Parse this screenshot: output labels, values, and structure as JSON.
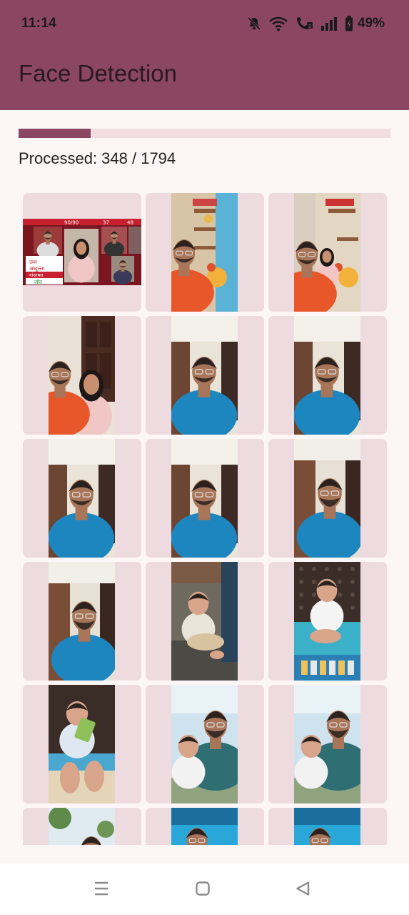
{
  "status_bar": {
    "time": "11:14",
    "battery": "49%",
    "icons": [
      "mute-bell-icon",
      "wifi-icon",
      "wifi-call-icon",
      "signal-icon",
      "battery-charging-icon"
    ]
  },
  "app_bar": {
    "title": "Face Detection"
  },
  "progress": {
    "label": "Processed: 348 / 1794",
    "processed": 348,
    "total": 1794,
    "fraction": 0.194,
    "track_color": "#f1dde2",
    "fill_color": "#8b4762"
  },
  "colors": {
    "primary": "#8b4762",
    "background": "#fdf6f7",
    "tile": "#eedbe0"
  },
  "photos": [
    {
      "orientation": "landscape",
      "scene": "news-panel",
      "overlay_text": [
        "90/90",
        "37",
        "48",
        "उमर",
        "अब्दुल्ला",
        "गांदरबल",
        "जीत"
      ]
    },
    {
      "orientation": "portrait",
      "scene": "selfie-temple"
    },
    {
      "orientation": "portrait",
      "scene": "selfie-temple-couple"
    },
    {
      "orientation": "portrait",
      "scene": "selfie-couple-door"
    },
    {
      "orientation": "portrait",
      "scene": "selfie-blue-shirt"
    },
    {
      "orientation": "portrait",
      "scene": "selfie-blue-shirt"
    },
    {
      "orientation": "portrait",
      "scene": "selfie-blue-shirt"
    },
    {
      "orientation": "portrait",
      "scene": "selfie-blue-shirt"
    },
    {
      "orientation": "portrait",
      "scene": "selfie-blue-shirt-beard"
    },
    {
      "orientation": "portrait",
      "scene": "selfie-blue-shirt-beard"
    },
    {
      "orientation": "portrait",
      "scene": "baby-on-sofa"
    },
    {
      "orientation": "portrait",
      "scene": "baby-on-mat"
    },
    {
      "orientation": "portrait",
      "scene": "baby-reading"
    },
    {
      "orientation": "portrait",
      "scene": "father-baby-outdoor"
    },
    {
      "orientation": "portrait",
      "scene": "father-baby-outdoor"
    },
    {
      "orientation": "portrait",
      "scene": "outdoor-tree"
    },
    {
      "orientation": "portrait",
      "scene": "pool-face"
    },
    {
      "orientation": "portrait",
      "scene": "pool-face"
    }
  ],
  "nav_bar": {
    "buttons": [
      "menu-icon",
      "home-square-icon",
      "back-triangle-icon"
    ]
  }
}
